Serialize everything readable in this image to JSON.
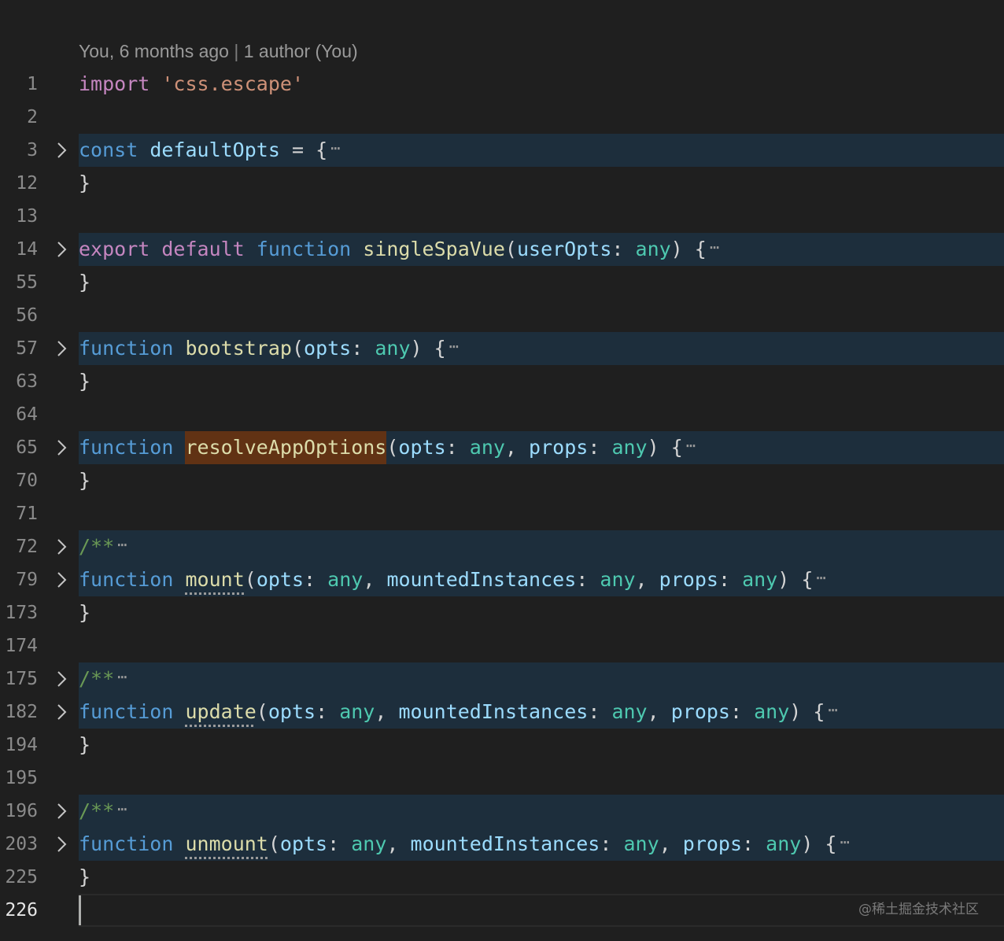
{
  "codelens": {
    "blame": "You, 6 months ago",
    "separator": "|",
    "authors": "1 author (You)"
  },
  "lines": [
    {
      "number": "1",
      "kw1": "import",
      "str": "'css.escape'"
    },
    {
      "number": "2"
    },
    {
      "number": "3",
      "kw1": "const",
      "name": "defaultOpts",
      "tail": "= {",
      "ellipsis": "⋯"
    },
    {
      "number": "12",
      "text": "}"
    },
    {
      "number": "13"
    },
    {
      "number": "14",
      "kw1": "export",
      "kw2": "default",
      "kw3": "function",
      "fn": "singleSpaVue",
      "open": "(",
      "p1": "userOpts",
      "colon1": ":",
      "t1": "any",
      "close": ") {",
      "ellipsis": "⋯"
    },
    {
      "number": "55",
      "text": "}"
    },
    {
      "number": "56"
    },
    {
      "number": "57",
      "kw1": "function",
      "fn": "bootstrap",
      "open": "(",
      "p1": "opts",
      "colon1": ":",
      "t1": "any",
      "close": ") {",
      "ellipsis": "⋯"
    },
    {
      "number": "63",
      "text": "}"
    },
    {
      "number": "64"
    },
    {
      "number": "65",
      "kw1": "function",
      "fn": "resolveAppOptions",
      "open": "(",
      "p1": "opts",
      "colon1": ":",
      "t1": "any",
      "comma1": ",",
      "p2": "props",
      "colon2": ":",
      "t2": "any",
      "close": ") {",
      "ellipsis": "⋯"
    },
    {
      "number": "70",
      "text": "}"
    },
    {
      "number": "71"
    },
    {
      "number": "72",
      "comment": "/**",
      "ellipsis": "⋯"
    },
    {
      "number": "79",
      "kw1": "function",
      "fn": "mount",
      "open": "(",
      "p1": "opts",
      "colon1": ":",
      "t1": "any",
      "comma1": ",",
      "p2": "mountedInstances",
      "colon2": ":",
      "t2": "any",
      "comma2": ",",
      "p3": "props",
      "colon3": ":",
      "t3": "any",
      "close": ") {",
      "ellipsis": "⋯"
    },
    {
      "number": "173",
      "text": "}"
    },
    {
      "number": "174"
    },
    {
      "number": "175",
      "comment": "/**",
      "ellipsis": "⋯"
    },
    {
      "number": "182",
      "kw1": "function",
      "fn": "update",
      "open": "(",
      "p1": "opts",
      "colon1": ":",
      "t1": "any",
      "comma1": ",",
      "p2": "mountedInstances",
      "colon2": ":",
      "t2": "any",
      "comma2": ",",
      "p3": "props",
      "colon3": ":",
      "t3": "any",
      "close": ") {",
      "ellipsis": "⋯"
    },
    {
      "number": "194",
      "text": "}"
    },
    {
      "number": "195"
    },
    {
      "number": "196",
      "comment": "/**",
      "ellipsis": "⋯"
    },
    {
      "number": "203",
      "kw1": "function",
      "fn": "unmount",
      "open": "(",
      "p1": "opts",
      "colon1": ":",
      "t1": "any",
      "comma1": ",",
      "p2": "mountedInstances",
      "colon2": ":",
      "t2": "any",
      "comma2": ",",
      "p3": "props",
      "colon3": ":",
      "t3": "any",
      "close": ") {",
      "ellipsis": "⋯"
    },
    {
      "number": "225",
      "text": "}"
    },
    {
      "number": "226"
    }
  ],
  "watermark": "@稀土掘金技术社区",
  "colors": {
    "background": "#1f1f1f",
    "folded_background": "#1d2e3c",
    "keyword_control": "#c586c0",
    "keyword_storage": "#569cd6",
    "string": "#ce9178",
    "function": "#dcdcaa",
    "variable": "#9cdcfe",
    "type": "#4ec9b0",
    "comment": "#6a9955",
    "find_match": "#613214"
  },
  "icons": {
    "fold": "chevron-right-icon"
  }
}
